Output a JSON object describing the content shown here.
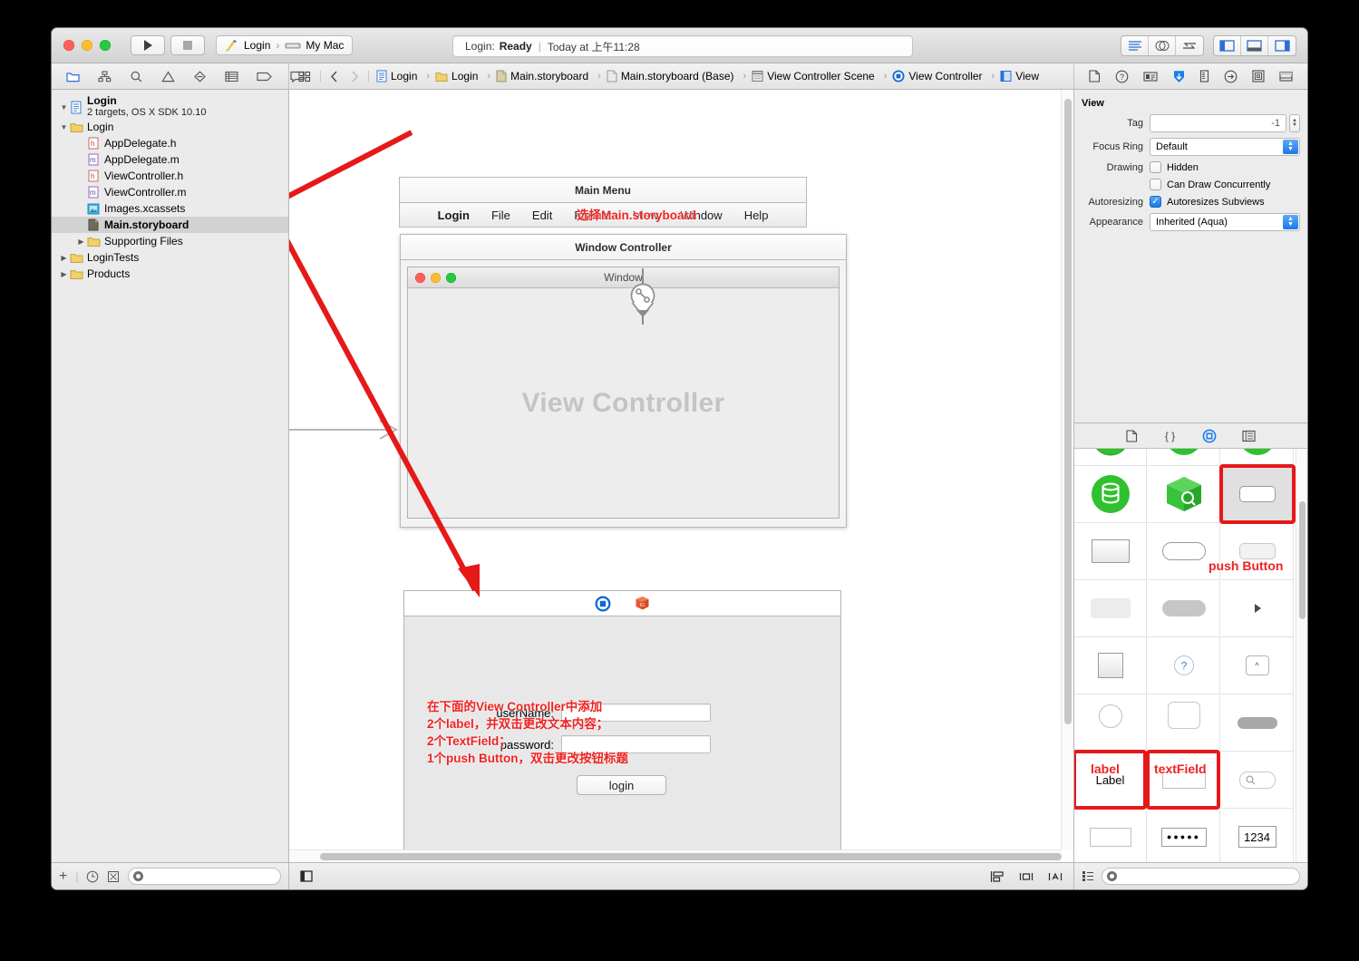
{
  "window": {
    "titlebar": {
      "run_label": "run-button",
      "stop_label": "stop-button",
      "scheme_name": "Login",
      "scheme_sep": "›",
      "destination": "My Mac",
      "status_prefix": "Login:",
      "status_state": "Ready",
      "status_divider": "|",
      "status_time": "Today at 上午11:28"
    },
    "breadcrumb": [
      {
        "label": "Login",
        "icon": "project-icon"
      },
      {
        "label": "Login",
        "icon": "folder-icon"
      },
      {
        "label": "Main.storyboard",
        "icon": "storyboard-icon"
      },
      {
        "label": "Main.storyboard (Base)",
        "icon": "storyboard-icon"
      },
      {
        "label": "View Controller Scene",
        "icon": "scene-icon"
      },
      {
        "label": "View Controller",
        "icon": "viewcontroller-icon"
      },
      {
        "label": "View",
        "icon": "view-icon"
      }
    ],
    "navigator_icons": [
      "folder-icon",
      "hierarchy-icon",
      "search-icon",
      "warning-icon",
      "issue-icon",
      "test-icon",
      "debug-icon",
      "breakpoint-icon",
      "log-icon"
    ]
  },
  "navigator": {
    "project_name": "Login",
    "project_subtitle": "2 targets, OS X SDK 10.10",
    "items": [
      {
        "label": "Login",
        "indent": 1,
        "icon": "folder-icon",
        "twisty": "down",
        "selected": false,
        "bold": false
      },
      {
        "label": "AppDelegate.h",
        "indent": 2,
        "icon": "header-icon",
        "twisty": "none",
        "selected": false,
        "bold": false
      },
      {
        "label": "AppDelegate.m",
        "indent": 2,
        "icon": "impl-icon",
        "twisty": "none",
        "selected": false,
        "bold": false
      },
      {
        "label": "ViewController.h",
        "indent": 2,
        "icon": "header-icon",
        "twisty": "none",
        "selected": false,
        "bold": false
      },
      {
        "label": "ViewController.m",
        "indent": 2,
        "icon": "impl-icon",
        "twisty": "none",
        "selected": false,
        "bold": false
      },
      {
        "label": "Images.xcassets",
        "indent": 2,
        "icon": "xcassets-icon",
        "twisty": "none",
        "selected": false,
        "bold": false
      },
      {
        "label": "Main.storyboard",
        "indent": 2,
        "icon": "storyboard-icon",
        "twisty": "none",
        "selected": true,
        "bold": true
      },
      {
        "label": "Supporting Files",
        "indent": 2,
        "icon": "folder-icon",
        "twisty": "right",
        "selected": false,
        "bold": false
      },
      {
        "label": "LoginTests",
        "indent": 1,
        "icon": "folder-icon",
        "twisty": "right",
        "selected": false,
        "bold": false
      },
      {
        "label": "Products",
        "indent": 1,
        "icon": "folder-icon",
        "twisty": "right",
        "selected": false,
        "bold": false
      }
    ],
    "footer": {
      "add_label": "+",
      "filter_placeholder": ""
    }
  },
  "canvas": {
    "main_menu": {
      "title": "Main Menu",
      "items": [
        "Login",
        "File",
        "Edit",
        "Format",
        "View",
        "Window",
        "Help"
      ],
      "bold_item": "Login"
    },
    "window_controller": {
      "title": "Window Controller",
      "window_title": "Window"
    },
    "view_controller_scene": {
      "placeholder": "View Controller",
      "icons": [
        "viewcontroller-icon",
        "first-responder-icon"
      ],
      "labels": [
        "userName:",
        "password:"
      ],
      "fields": [
        "",
        ""
      ],
      "button_label": "login"
    },
    "annotations": [
      {
        "id": "ann-select-storyboard",
        "text": "选择Main.storyboard"
      },
      {
        "id": "ann-add-controls",
        "text": "在下面的View Controller中添加\n2个label，并双击更改文本内容；\n2个TextField；\n1个push Button，双击更改按钮标题"
      }
    ]
  },
  "inspector": {
    "tabs": [
      "file-inspector-icon",
      "quick-help-icon",
      "identity-inspector-icon",
      "attributes-inspector-icon",
      "size-inspector-icon",
      "connections-inspector-icon",
      "bindings-inspector-icon",
      "effects-inspector-icon"
    ],
    "active_tab_index": 3,
    "section_title": "View",
    "fields": [
      {
        "label": "Tag",
        "type": "stepper",
        "value": "-1"
      },
      {
        "label": "Focus Ring",
        "type": "popup",
        "value": "Default"
      },
      {
        "label": "Drawing",
        "type": "checkbox",
        "value": "Hidden",
        "checked": false
      },
      {
        "label": "",
        "type": "checkbox",
        "value": "Can Draw Concurrently",
        "checked": false
      },
      {
        "label": "Autoresizing",
        "type": "checkbox",
        "value": "Autoresizes Subviews",
        "checked": true
      },
      {
        "label": "Appearance",
        "type": "popup",
        "value": "Inherited (Aqua)"
      }
    ]
  },
  "library": {
    "tabs": [
      "file-template-icon",
      "code-snippet-icon",
      "object-library-icon",
      "media-library-icon"
    ],
    "active_tab_index": 2,
    "annotations": [
      {
        "id": "ann-push-button",
        "text": "push Button"
      },
      {
        "id": "ann-label",
        "text": "label"
      },
      {
        "id": "ann-textfield",
        "text": "textField"
      }
    ],
    "cells": [
      {
        "row": 0,
        "col": 0,
        "icon": "green-circle-partial"
      },
      {
        "row": 0,
        "col": 1,
        "icon": "green-circle-partial"
      },
      {
        "row": 0,
        "col": 2,
        "icon": "green-circle-partial"
      },
      {
        "row": 1,
        "col": 0,
        "icon": "core-data-icon"
      },
      {
        "row": 1,
        "col": 1,
        "icon": "object-cube-icon"
      },
      {
        "row": 1,
        "col": 2,
        "icon": "push-button-icon",
        "highlighted": true
      },
      {
        "row": 2,
        "col": 0,
        "icon": "gradient-button-icon"
      },
      {
        "row": 2,
        "col": 1,
        "icon": "rounded-rect-button-icon"
      },
      {
        "row": 2,
        "col": 2,
        "icon": "rounded-textured-button-icon"
      },
      {
        "row": 3,
        "col": 0,
        "icon": "recessed-button-icon"
      },
      {
        "row": 3,
        "col": 1,
        "icon": "rounded-bezel-icon"
      },
      {
        "row": 3,
        "col": 2,
        "icon": "disclosure-triangle-icon"
      },
      {
        "row": 4,
        "col": 0,
        "icon": "square-button-icon"
      },
      {
        "row": 4,
        "col": 1,
        "icon": "help-button-icon"
      },
      {
        "row": 4,
        "col": 2,
        "icon": "disclosure-button-icon"
      },
      {
        "row": 5,
        "col": 0,
        "icon": "round-button-icon"
      },
      {
        "row": 5,
        "col": 1,
        "icon": "rounded-textfield-icon"
      },
      {
        "row": 5,
        "col": 2,
        "icon": "capsule-icon"
      },
      {
        "row": 6,
        "col": 0,
        "icon": "label-icon",
        "label": "Label",
        "highlighted": true
      },
      {
        "row": 6,
        "col": 1,
        "icon": "textfield-icon",
        "highlighted": true
      },
      {
        "row": 6,
        "col": 2,
        "icon": "search-field-icon"
      },
      {
        "row": 7,
        "col": 0,
        "icon": "wrapping-label-icon"
      },
      {
        "row": 7,
        "col": 1,
        "icon": "secure-textfield-icon",
        "label": "●●●●●"
      },
      {
        "row": 7,
        "col": 2,
        "icon": "number-formatter-icon",
        "label": "1234"
      }
    ],
    "footer": {
      "view_mode": "list-view-icon",
      "search_placeholder": ""
    }
  },
  "footer": {
    "editor_left_icon": "toggle-navigator-icon",
    "editor_right_icons": [
      "align-icon",
      "resolve-icon",
      "resize-icon"
    ]
  }
}
